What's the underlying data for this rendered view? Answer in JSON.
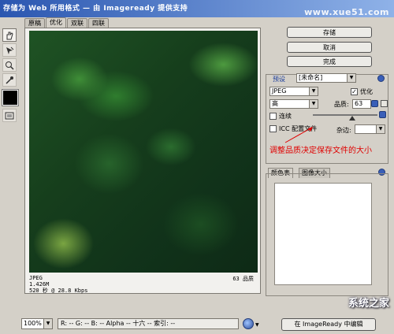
{
  "window": {
    "title": "存储为 Web 所用格式 — 由 Imageready 提供支持",
    "watermark": "www.xue51.com"
  },
  "tabs": [
    "原稿",
    "优化",
    "双联",
    "四联"
  ],
  "tools": [
    {
      "icon": "hand-icon"
    },
    {
      "icon": "slice-select-icon"
    },
    {
      "icon": "zoom-icon"
    },
    {
      "icon": "eyedropper-icon"
    }
  ],
  "canvas": {
    "info_left": [
      "JPEG",
      "1.426M",
      "520 秒 @ 28.8 Kbps"
    ],
    "info_right": "63 品质"
  },
  "buttons": {
    "save": "存储",
    "cancel": "取消",
    "done": "完成"
  },
  "settings": {
    "preset_label": "预设",
    "preset_value": "[未命名]",
    "format": "JPEG",
    "optimized_label": "优化",
    "optimized_checked": true,
    "quality_level": "高",
    "quality_label": "品质:",
    "quality_value": "63",
    "progressive_label": "连续",
    "progressive_checked": false,
    "icc_label": "ICC 配置文件",
    "icc_checked": false,
    "matte_label": "杂边:",
    "annotation": "调整品质决定保存文件的大小"
  },
  "panel_tabs": [
    "颜色表",
    "图像大小"
  ],
  "status": {
    "zoom": "100%",
    "readout": "R: --  G: --  B: --  Alpha -- 十六  -- 索引: --",
    "imageready_button": "在 ImageReady 中编辑",
    "logo": "系统之家"
  },
  "colors": {
    "accent": "#2a56b0",
    "annotation": "#e00000",
    "panel_bg": "#d4d0c8"
  }
}
